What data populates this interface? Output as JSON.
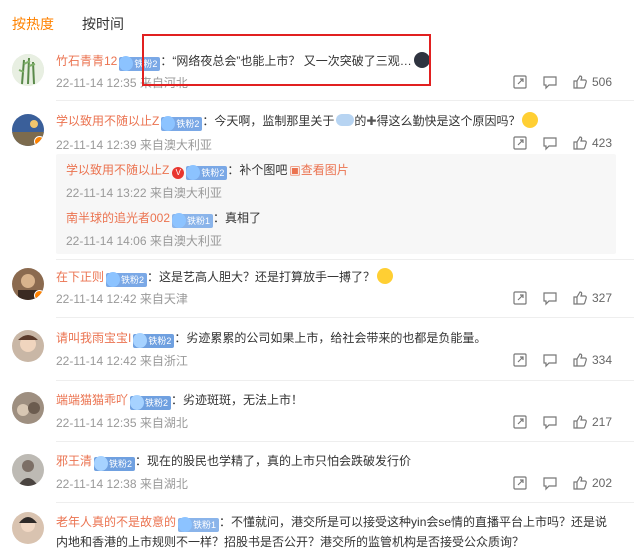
{
  "tabs": [
    {
      "label": "按热度",
      "active": true
    },
    {
      "label": "按时间",
      "active": false
    }
  ],
  "comments": [
    {
      "name": "竹石青青12",
      "fan": "铁粉2",
      "text": "：“网络夜总会”也能上市？ 又一次突破了三观…",
      "meta": "22-11-14 12:35 来自河北",
      "likes": "506"
    },
    {
      "name": "学以致用不随以止Z",
      "fan": "铁粉2",
      "text_a": "：今天啊，监制那里关于",
      "text_b": "的",
      "text_c": "得这么勤快是这个原因吗？",
      "meta": "22-11-14 12:39 来自澳大利亚",
      "likes": "423",
      "replies": [
        {
          "name": "学以致用不随以止Z",
          "fan": "铁粉2",
          "text": "：补个图吧",
          "link": "查看图片",
          "meta": "22-11-14 13:22 来自澳大利亚"
        },
        {
          "name": "南半球的追光者002",
          "fan": "铁粉1",
          "text": "：真相了",
          "meta": "22-11-14 14:06 来自澳大利亚"
        }
      ]
    },
    {
      "name": "在下正则",
      "fan": "铁粉2",
      "text": "：这是艺高人胆大？还是打算放手一搏了？",
      "meta": "22-11-14 12:42 来自天津",
      "likes": "327"
    },
    {
      "name": "请叫我雨宝宝I",
      "fan": "铁粉2",
      "text": "：劣迹累累的公司如果上市，给社会带来的也都是负能量。",
      "meta": "22-11-14 12:42 来自浙江",
      "likes": "334"
    },
    {
      "name": "端端猫猫乖吖",
      "fan": "铁粉2",
      "text": "：劣迹斑斑，无法上市！",
      "meta": "22-11-14 12:35 来自湖北",
      "likes": "217"
    },
    {
      "name": "邪王清",
      "fan": "铁粉2",
      "text": "：现在的股民也学精了，真的上市只怕会跌破发行价",
      "meta": "22-11-14 12:38 来自湖北",
      "likes": "202"
    },
    {
      "name": "老年人真的不是故意的",
      "fan": "铁粉1",
      "text": "：不懂就问，港交所是可以接受这种yin会se情的直播平台上市吗？还是说",
      "text2": "内地和香港的上市规则不一样？招股书是否公开？港交所的监管机构是否接受公众质询？"
    }
  ],
  "colors": {
    "accent": "#ff8200",
    "username": "#eb7350",
    "meta": "#999999",
    "highlight": "#e12020"
  }
}
